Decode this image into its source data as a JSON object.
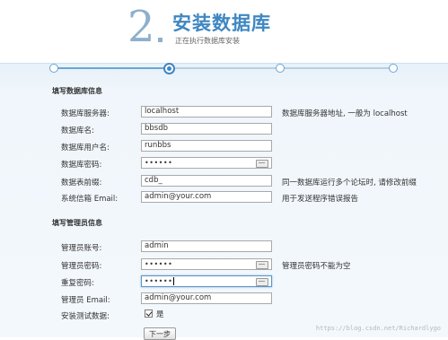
{
  "header": {
    "step_number": "2",
    "title": "安装数据库",
    "subtitle": "正在执行数据库安装"
  },
  "progress": {
    "total_steps": 4,
    "current_step": 2
  },
  "db_section": {
    "heading": "填写数据库信息",
    "fields": [
      {
        "label": "数据库服务器:",
        "value": "localhost",
        "hint": "数据库服务器地址, 一般为 localhost"
      },
      {
        "label": "数据库名:",
        "value": "bbsdb",
        "hint": ""
      },
      {
        "label": "数据库用户名:",
        "value": "runbbs",
        "hint": ""
      },
      {
        "label": "数据库密码:",
        "value": "••••••",
        "hint": ""
      },
      {
        "label": "数据表前缀:",
        "value": "cdb_",
        "hint": "同一数据库运行多个论坛时, 请修改前缀"
      },
      {
        "label": "系统信箱 Email:",
        "value": "admin@your.com",
        "hint": "用于发送程序错误报告"
      }
    ]
  },
  "admin_section": {
    "heading": "填写管理员信息",
    "fields": [
      {
        "label": "管理员账号:",
        "value": "admin",
        "hint": ""
      },
      {
        "label": "管理员密码:",
        "value": "••••••",
        "hint": "管理员密码不能为空"
      },
      {
        "label": "重复密码:",
        "value": "••••••",
        "hint": ""
      },
      {
        "label": "管理员 Email:",
        "value": "admin@your.com",
        "hint": ""
      }
    ],
    "test_data_label": "安装测试数据:",
    "test_data_checked": true,
    "test_data_option": "是"
  },
  "next_button": "下一步",
  "watermark": "https://blog.csdn.net/Richardlygo",
  "colors": {
    "accent": "#3f87c2",
    "step_number": "#8fb0cc",
    "background": "#f0f6fb"
  }
}
